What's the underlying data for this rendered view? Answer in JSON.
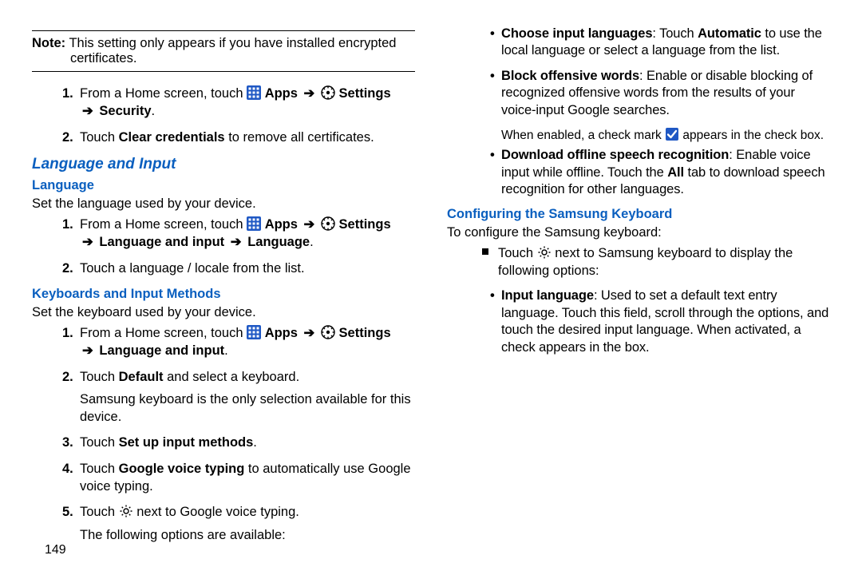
{
  "pageNumber": "149",
  "note": {
    "prefix": "Note:",
    "text": "This setting only appears if you have installed encrypted certificates."
  },
  "arrow": "➔",
  "labels": {
    "apps": "Apps",
    "settings": "Settings",
    "security": "Security",
    "langInput": "Language and input",
    "language": "Language"
  },
  "sec1": {
    "s1_pre": "From a Home screen, touch",
    "s1_end": ".",
    "s2_pre": "Touch ",
    "s2_bold": "Clear credentials",
    "s2_post": " to remove all certificates."
  },
  "h_main": "Language and Input",
  "h_lang": "Language",
  "lang_intro": "Set the language used by your device.",
  "lang": {
    "s1_pre": "From a Home screen, touch",
    "s1_end": ".",
    "s2": "Touch a language / locale from the list."
  },
  "h_kbd": "Keyboards and Input Methods",
  "kbd_intro": "Set the keyboard used by your device.",
  "kbd": {
    "s1_pre": "From a Home screen, touch",
    "s1_end": ".",
    "s2_pre": "Touch ",
    "s2_bold": "Default",
    "s2_post": " and select a keyboard.",
    "s2_extra": "Samsung keyboard is the only selection available for this device.",
    "s3_pre": "Touch ",
    "s3_bold": "Set up input methods",
    "s3_post": ".",
    "s4_pre": "Touch ",
    "s4_bold": "Google voice typing",
    "s4_post": " to automatically use Google voice typing.",
    "s5_part1": "Touch ",
    "s5_part2": " next to Google voice typing.",
    "s5_extra": "The following options are available:"
  },
  "gbullets": {
    "b1_bold": "Choose input languages",
    "b1_mid": ": Touch ",
    "b1_bold2": "Automatic",
    "b1_rest": " to use the local language or select a language from the list.",
    "b2_bold": "Block offensive words",
    "b2_rest": ": Enable or disable blocking of recognized offensive words from the results of your voice-input Google searches.",
    "b2_note_a": "When enabled, a check mark ",
    "b2_note_b": " appears in the check box.",
    "b3_bold": "Download offline speech recognition",
    "b3_mid": ": Enable voice input while offline. Touch the ",
    "b3_bold2": "All",
    "b3_rest": " tab to download speech recognition for other languages."
  },
  "h_cfg": "Configuring the Samsung Keyboard",
  "cfg_intro": "To configure the Samsung keyboard:",
  "cfg_sq1_a": "Touch ",
  "cfg_sq1_b": " next to Samsung keyboard to display the following options:",
  "cfg_b1_bold": "Input language",
  "cfg_b1_rest": ": Used to set a default text entry language. Touch this field, scroll through the options, and touch the desired input language. When activated, a check appears in the box."
}
